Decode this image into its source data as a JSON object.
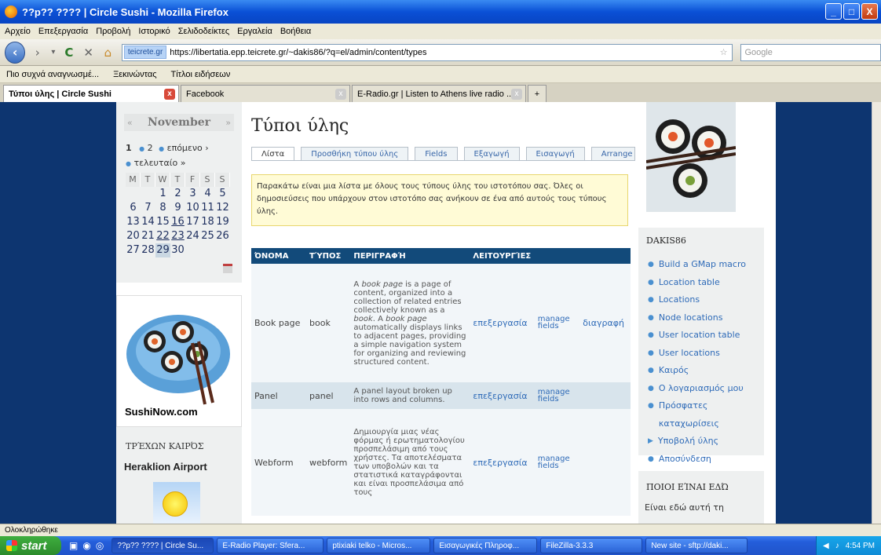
{
  "window": {
    "title": "??p?? ???? | Circle Sushi - Mozilla Firefox",
    "btn_min": "_",
    "btn_max": "□",
    "btn_close": "X"
  },
  "menu": [
    "Αρχείο",
    "Επεξεργασία",
    "Προβολή",
    "Ιστορικό",
    "Σελιδοδείκτες",
    "Εργαλεία",
    "Βοήθεια"
  ],
  "nav": {
    "back": "‹",
    "forward": "›",
    "dropdown": "▾",
    "reload": "C",
    "stop": "✕",
    "home": "⌂",
    "site_badge": "teicrete.gr",
    "url": "https://libertatia.epp.teicrete.gr/~dakis86/?q=el/admin/content/types",
    "star": "☆",
    "search_placeholder": "Google"
  },
  "bookmarks": [
    "Πιο συχνά αναγνωσμέ...",
    "Ξεκινώντας",
    "Τίτλοι ειδήσεων"
  ],
  "browser_tabs": [
    {
      "label": "Τύποι ύλης | Circle Sushi",
      "close": "x"
    },
    {
      "label": "Facebook",
      "close": "x"
    },
    {
      "label": "E-Radio.gr | Listen to Athens live radio ...",
      "close": "x"
    },
    {
      "label": "+"
    }
  ],
  "calendar": {
    "prev": "«",
    "month": "November",
    "next": "»",
    "pager": {
      "current": "1",
      "page2": "2",
      "next": "επόμενο ›",
      "last": "τελευταίο »"
    },
    "headers": [
      "M",
      "T",
      "W",
      "T",
      "F",
      "S",
      "S"
    ],
    "days": [
      "",
      "",
      "1",
      "2",
      "3",
      "4",
      "5",
      "6",
      "7",
      "8",
      "9",
      "10",
      "11",
      "12",
      "13",
      "14",
      "15",
      "16",
      "17",
      "18",
      "19",
      "20",
      "21",
      "22",
      "23",
      "24",
      "25",
      "26",
      "27",
      "28",
      "29",
      "30"
    ]
  },
  "ad": {
    "brand": "SushiNow.com"
  },
  "weather": {
    "title": "ΤΡΈΧΩΝ ΚΑΙΡΌΣ",
    "city": "Heraklion Airport"
  },
  "content": {
    "title": "Τύποι ύλης",
    "tabs": [
      "Λίστα",
      "Προσθήκη τύπου ύλης",
      "Fields",
      "Εξαγωγή",
      "Εισαγωγή",
      "Arrange"
    ],
    "help": "Παρακάτω είναι μια λίστα με όλους τους τύπους ύλης του ιστοτόπου σας. Όλες οι δημοσιεύσεις που υπάρχουν στον ιστοτόπο σας ανήκουν σε ένα από αυτούς τους τύπους ύλης.",
    "columns": [
      "ΌΝΟΜΑ",
      "ΤΎΠΟΣ",
      "ΠΕΡΙΓΡΑΦΉ",
      "ΛΕΙΤΟΥΡΓΊΕΣ"
    ],
    "rows": [
      {
        "name": "Book page",
        "type": "book",
        "desc_parts": [
          "A ",
          "book page",
          " is a page of content, organized into a collection of related entries collectively known as a ",
          "book",
          ". A ",
          "book page",
          " automatically displays links to adjacent pages, providing a simple navigation system for organizing and reviewing structured content."
        ],
        "edit": "επεξεργασία",
        "manage": "manage fields",
        "delete": "διαγραφή"
      },
      {
        "name": "Panel",
        "type": "panel",
        "desc": "A panel layout broken up into rows and columns.",
        "edit": "επεξεργασία",
        "manage": "manage fields"
      },
      {
        "name": "Webform",
        "type": "webform",
        "desc": "Δημιουργία μιας νέας φόρμας ή ερωτηματολογίου προσπελάσιμη από τους χρήστες. Τα αποτελέσματα των υποβολών και τα στατιστικά καταγράφονται και είναι προσπελάσιμα από τους",
        "edit": "επεξεργασία",
        "manage": "manage fields"
      }
    ]
  },
  "userblock": {
    "title": "DAKIS86",
    "links": [
      "Build a GMap macro",
      "Location table",
      "Locations",
      "Node locations",
      "User location table",
      "User locations",
      "Καιρός",
      "Ο λογαριασμός μου",
      "Πρόσφατες καταχωρίσεις",
      "Υποβολή ύλης",
      "Αποσύνδεση"
    ]
  },
  "who": {
    "title": "ΠΟΙΟΙ ΕΊΝΑΙ ΕΔΏ",
    "text": "Είναι εδώ αυτή τη"
  },
  "status": "Ολοκληρώθηκε",
  "taskbar": {
    "start": "start",
    "tasks": [
      "??p?? ???? | Circle Su...",
      "E-Radio Player: Sfera...",
      "ptixiaki telko - Micros...",
      "Εισαγωγικές Πληροφ...",
      "FileZilla-3.3.3",
      "New site - sftp://daki..."
    ],
    "clock": "4:54 PM"
  },
  "colors": {
    "accent": "#124a7a",
    "link": "#2f6bb8",
    "page_bg": "#0d3570",
    "help_bg": "#fffbd6"
  }
}
